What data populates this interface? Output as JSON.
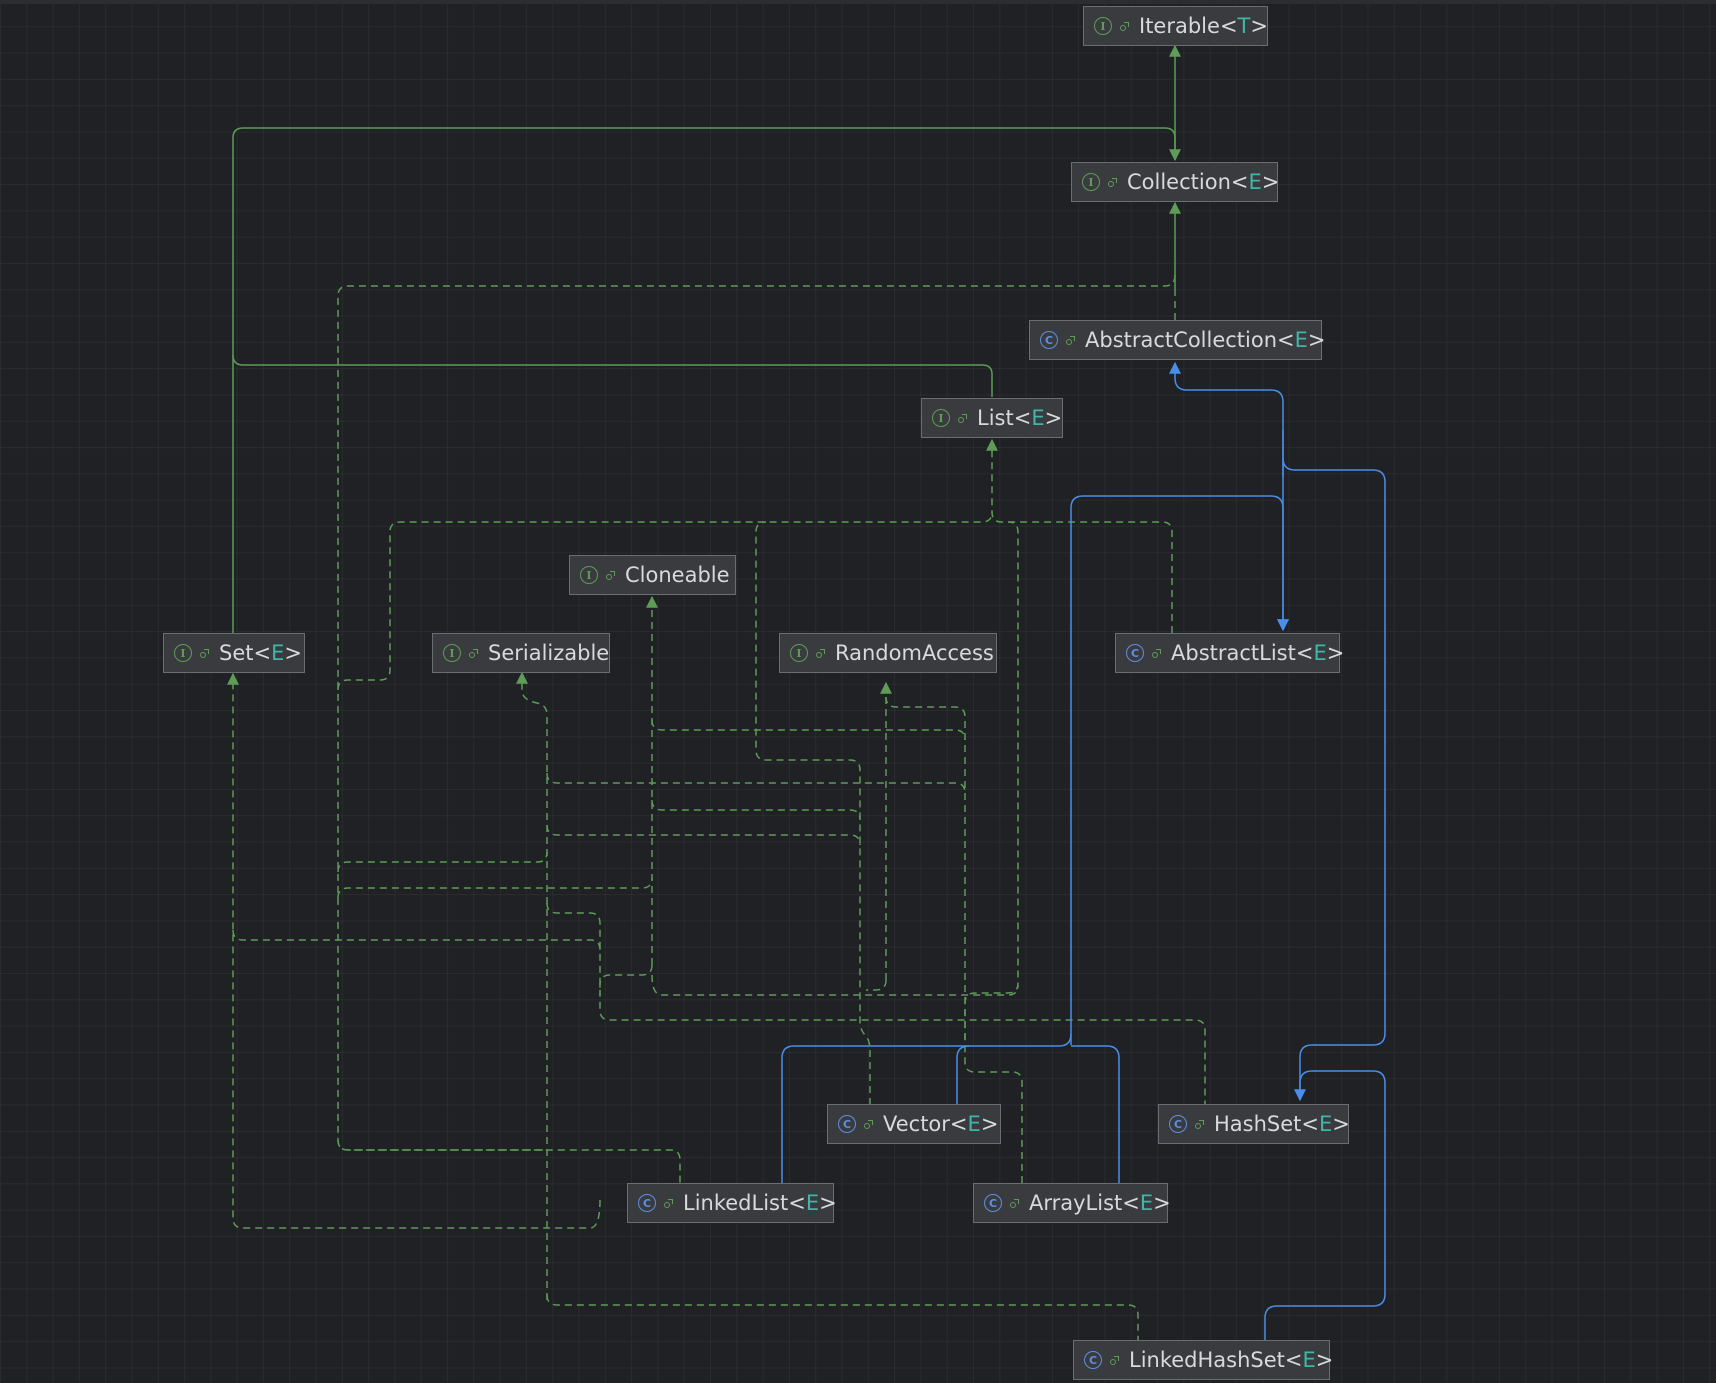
{
  "diagram": {
    "nodes": [
      {
        "id": "iterable",
        "kind": "interface",
        "name": "Iterable",
        "type_param": "T"
      },
      {
        "id": "collection",
        "kind": "interface",
        "name": "Collection",
        "type_param": "E"
      },
      {
        "id": "abstract_collection",
        "kind": "class",
        "name": "AbstractCollection",
        "type_param": "E"
      },
      {
        "id": "list",
        "kind": "interface",
        "name": "List",
        "type_param": "E"
      },
      {
        "id": "cloneable",
        "kind": "interface",
        "name": "Cloneable",
        "type_param": ""
      },
      {
        "id": "set",
        "kind": "interface",
        "name": "Set",
        "type_param": "E"
      },
      {
        "id": "serializable",
        "kind": "interface",
        "name": "Serializable",
        "type_param": ""
      },
      {
        "id": "random_access",
        "kind": "interface",
        "name": "RandomAccess",
        "type_param": ""
      },
      {
        "id": "abstract_list",
        "kind": "class",
        "name": "AbstractList",
        "type_param": "E"
      },
      {
        "id": "vector",
        "kind": "class",
        "name": "Vector",
        "type_param": "E"
      },
      {
        "id": "hash_set",
        "kind": "class",
        "name": "HashSet",
        "type_param": "E"
      },
      {
        "id": "linked_list",
        "kind": "class",
        "name": "LinkedList",
        "type_param": "E"
      },
      {
        "id": "array_list",
        "kind": "class",
        "name": "ArrayList",
        "type_param": "E"
      },
      {
        "id": "linked_hash_set",
        "kind": "class",
        "name": "LinkedHashSet",
        "type_param": "E"
      }
    ],
    "edges": [
      {
        "from": "collection",
        "to": "iterable",
        "style": "extends"
      },
      {
        "from": "list",
        "to": "collection",
        "style": "extends"
      },
      {
        "from": "set",
        "to": "collection",
        "style": "extends"
      },
      {
        "from": "abstract_collection",
        "to": "collection",
        "style": "implements"
      },
      {
        "from": "abstract_list",
        "to": "abstract_collection",
        "style": "class-extends"
      },
      {
        "from": "hash_set",
        "to": "abstract_collection",
        "style": "class-extends"
      },
      {
        "from": "abstract_list",
        "to": "list",
        "style": "implements"
      },
      {
        "from": "array_list",
        "to": "abstract_list",
        "style": "class-extends"
      },
      {
        "from": "vector",
        "to": "abstract_list",
        "style": "class-extends"
      },
      {
        "from": "linked_list",
        "to": "abstract_list",
        "style": "class-extends"
      },
      {
        "from": "linked_hash_set",
        "to": "hash_set",
        "style": "class-extends"
      },
      {
        "from": "hash_set",
        "to": "set",
        "style": "implements"
      },
      {
        "from": "linked_hash_set",
        "to": "set",
        "style": "implements"
      },
      {
        "from": "array_list",
        "to": "list",
        "style": "implements"
      },
      {
        "from": "vector",
        "to": "list",
        "style": "implements"
      },
      {
        "from": "linked_list",
        "to": "list",
        "style": "implements"
      },
      {
        "from": "array_list",
        "to": "random_access",
        "style": "implements"
      },
      {
        "from": "vector",
        "to": "random_access",
        "style": "implements"
      },
      {
        "from": "array_list",
        "to": "cloneable",
        "style": "implements"
      },
      {
        "from": "vector",
        "to": "cloneable",
        "style": "implements"
      },
      {
        "from": "linked_list",
        "to": "cloneable",
        "style": "implements"
      },
      {
        "from": "hash_set",
        "to": "cloneable",
        "style": "implements"
      },
      {
        "from": "array_list",
        "to": "serializable",
        "style": "implements"
      },
      {
        "from": "vector",
        "to": "serializable",
        "style": "implements"
      },
      {
        "from": "linked_list",
        "to": "serializable",
        "style": "implements"
      },
      {
        "from": "hash_set",
        "to": "serializable",
        "style": "implements"
      },
      {
        "from": "linked_hash_set",
        "to": "serializable",
        "style": "implements"
      }
    ]
  },
  "colors": {
    "interface_edge": "#5e9c58",
    "class_edge": "#4a8ee8",
    "node_fill": "#393b3f",
    "node_border": "#6a6d72",
    "type_param": "#3fb6a8",
    "background": "#1f2125"
  },
  "icons": {
    "interface": "interface-icon",
    "class": "class-icon",
    "visibility": "public-visibility-icon"
  }
}
